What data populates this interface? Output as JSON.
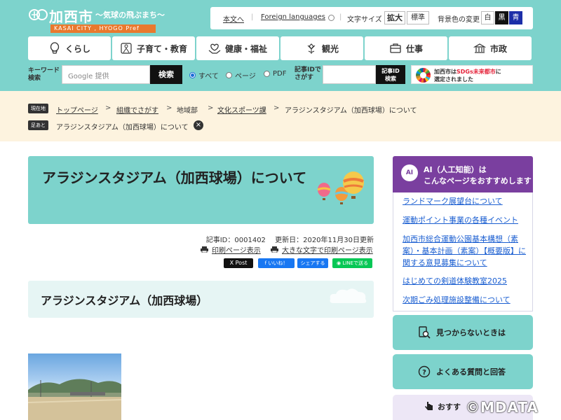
{
  "site": {
    "name": "加西市",
    "tagline": "〜気球の飛ぶまち〜",
    "subname": "KASAI CITY , HYOGO Pref"
  },
  "util": {
    "main_text": "本文へ",
    "foreign": "Foreign languages",
    "font_size_label": "文字サイズ",
    "font_large": "拡大",
    "font_standard": "標準",
    "bg_label": "背景色の変更",
    "bg_white": "白",
    "bg_black": "黒",
    "bg_blue": "青"
  },
  "nav": [
    {
      "label": "くらし",
      "icon": "balloon-icon"
    },
    {
      "label": "子育て・教育",
      "icon": "child-icon"
    },
    {
      "label": "健康・福祉",
      "icon": "hands-icon"
    },
    {
      "label": "観光",
      "icon": "flower-icon"
    },
    {
      "label": "仕事",
      "icon": "briefcase-icon"
    },
    {
      "label": "市政",
      "icon": "building-icon"
    }
  ],
  "search": {
    "label": "キーワード\n検索",
    "placeholder": "Google 提供",
    "button": "検索",
    "options": [
      "すべて",
      "ページ",
      "PDF"
    ],
    "selected": "すべて",
    "id_label": "記事IDで\nさがす",
    "id_button": "記事ID\n検索"
  },
  "sdgs": {
    "line1_prefix": "加西市は",
    "line1_em": "SDGs未来都市",
    "line1_suffix": "に",
    "line2": "選定されました"
  },
  "breadcrumb": {
    "current_tag": "現在地",
    "items": [
      "トップページ",
      "組織でさがす",
      "地域部",
      "文化スポーツ課",
      "アラジンスタジアム（加西球場）について"
    ],
    "separator": ">",
    "footprint_tag": "足あと",
    "footprint_item": "アラジンスタジアム（加西球場）について"
  },
  "article": {
    "title": "アラジンスタジアム（加西球場）について",
    "meta": "記事ID：0001402　 更新日：2020年11月30日更新",
    "print": "印刷ページ表示",
    "print_large": "大きな文字で印刷ページ表示",
    "social": {
      "x": "X Post",
      "fb_like": "いいね！",
      "fb_share": "シェアする",
      "line": "LINEで送る"
    },
    "heading": "アラジンスタジアム（加西球場）"
  },
  "sidebar": {
    "ai_badge": "AI",
    "ai_title1": "AI（人工知能）は",
    "ai_title2": "こんなページをおすすめします",
    "ai_links": [
      "ランドマーク展望台について",
      "運動ポイント事業の各種イベント",
      "加西市総合運動公園基本構想（素案）・基本計画（素案）【概要版】に関する意見募集について",
      "はじめての剣道体験教室2025",
      "次期ごみ処理施設整備について"
    ],
    "btn_not_found": "見つからないときは",
    "btn_faq": "よくある質問と回答",
    "btn_last": "おすす"
  },
  "watermark": "©MDATA",
  "colors": {
    "teal": "#7dd3cc",
    "purple": "#7a3f9f",
    "cream": "#fdf3df",
    "link": "#1a5ed1",
    "orange": "#e9792e"
  }
}
